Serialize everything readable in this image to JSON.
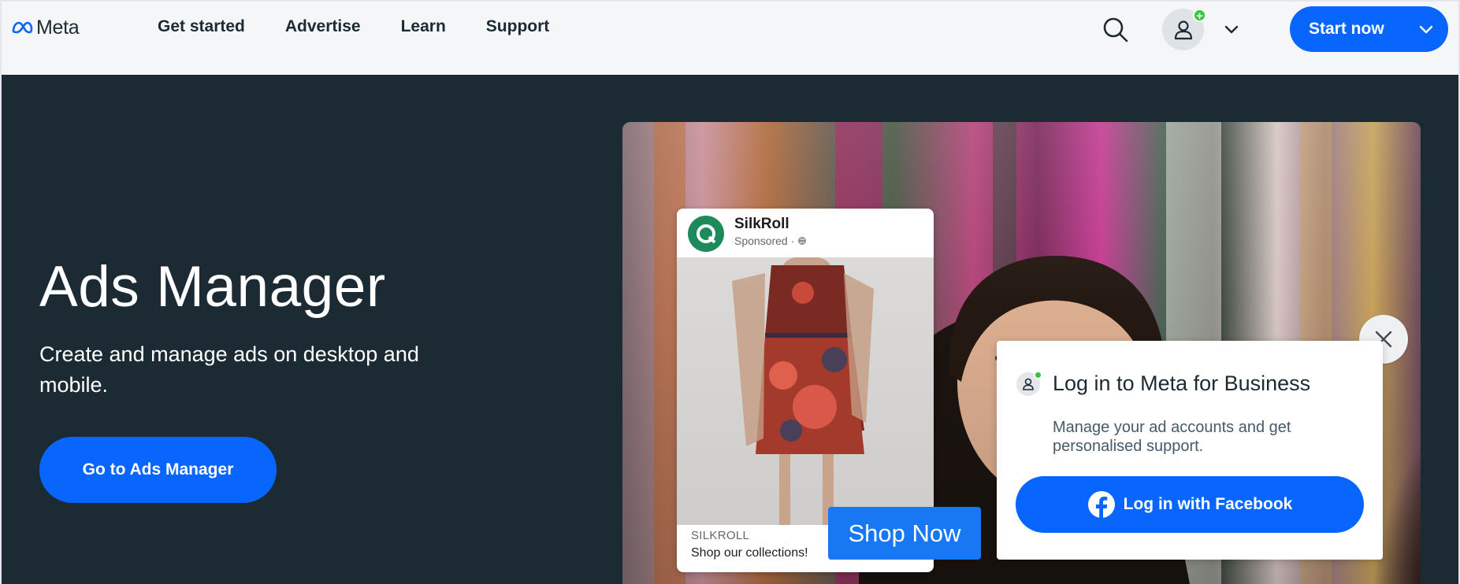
{
  "header": {
    "logo_text": "Meta",
    "nav": [
      "Get started",
      "Advertise",
      "Learn",
      "Support"
    ],
    "start_now_label": "Start now"
  },
  "hero": {
    "title": "Ads Manager",
    "subtitle": "Create and manage ads on desktop and mobile.",
    "cta_label": "Go to Ads Manager"
  },
  "ad_preview": {
    "brand": "SilkRoll",
    "sponsored": "Sponsored ·",
    "caption_brand": "SILKROLL",
    "caption_text": "Shop our collections!",
    "shop_button": "Shop Now"
  },
  "login_popup": {
    "title": "Log in to Meta for Business",
    "description": "Manage your ad accounts and get personalised support.",
    "button_label": "Log in with Facebook"
  },
  "colors": {
    "primary": "#0866ff",
    "hero_bg": "#1c2b33",
    "status_green": "#35c43b",
    "facebook_blue": "#1877f2"
  }
}
